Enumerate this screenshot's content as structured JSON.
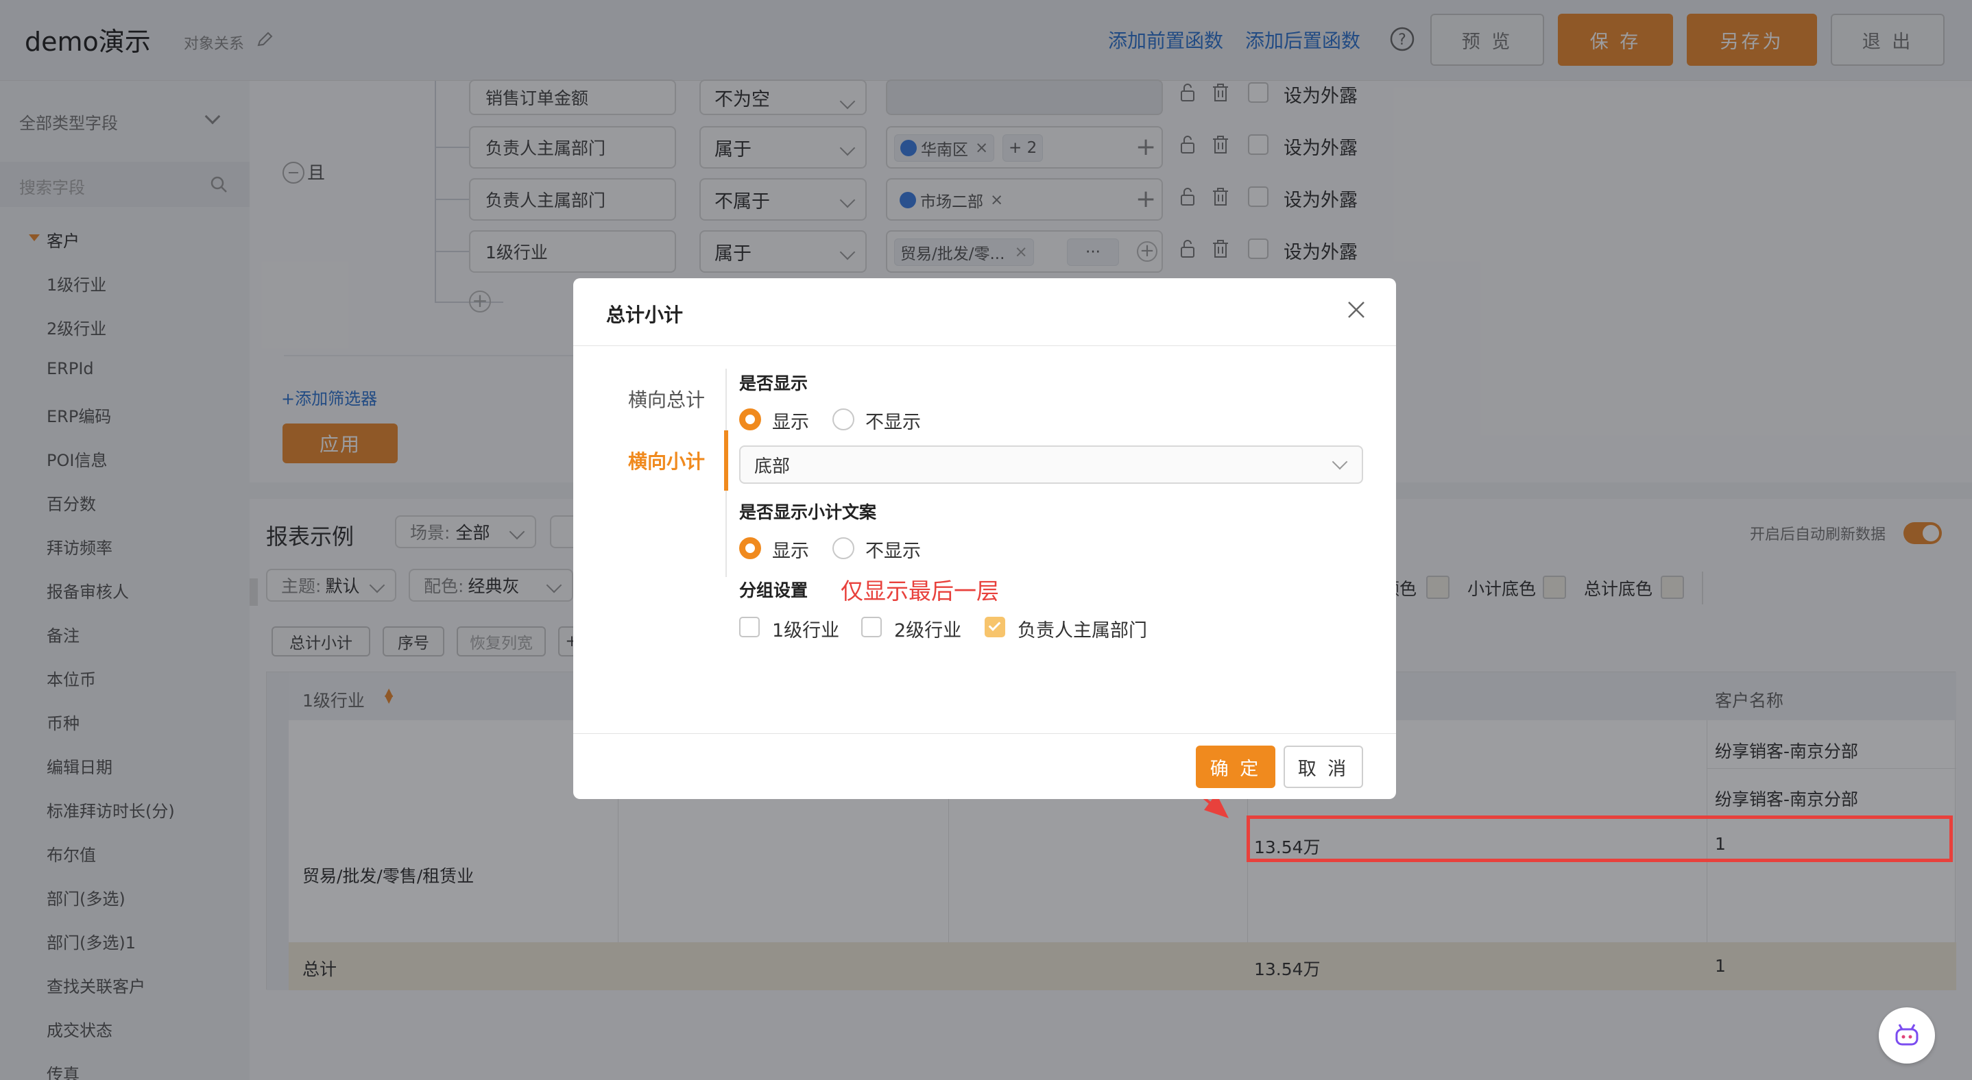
{
  "header": {
    "app_title": "demo演示",
    "object_relation": "对象关系",
    "add_pre_function": "添加前置函数",
    "add_post_function": "添加后置函数",
    "preview": "预 览",
    "save": "保 存",
    "save_as": "另存为",
    "exit": "退 出"
  },
  "sidebar": {
    "field_type": "全部类型字段",
    "search_placeholder": "搜索字段",
    "group": "客户",
    "items": [
      "1级行业",
      "2级行业",
      "ERPId",
      "ERP编码",
      "POI信息",
      "百分数",
      "拜访频率",
      "报备审核人",
      "备注",
      "本位币",
      "币种",
      "编辑日期",
      "标准拜访时长(分)",
      "布尔值",
      "部门(多选)",
      "部门(多选)1",
      "查找关联客户",
      "成交状态",
      "传真"
    ]
  },
  "filters": {
    "logic_label": "且",
    "rows": [
      {
        "field": "销售订单金额",
        "operator": "不为空",
        "values": [],
        "expose": "设为外露"
      },
      {
        "field": "负责人主属部门",
        "operator": "属于",
        "values": [
          "华南区"
        ],
        "extra_count": "+ 2",
        "expose": "设为外露"
      },
      {
        "field": "负责人主属部门",
        "operator": "不属于",
        "values": [
          "市场二部"
        ],
        "expose": "设为外露"
      },
      {
        "field": "1级行业",
        "operator": "属于",
        "values": [
          "贸易/批发/零..."
        ],
        "more": "···",
        "expose": "设为外露"
      }
    ],
    "add_filter": "+添加筛选器",
    "apply": "应用"
  },
  "report": {
    "title": "报表示例",
    "scene_label": "场景:",
    "scene_value": "全部",
    "theme_label": "主题:",
    "theme_value": "默认",
    "color_label": "配色:",
    "color_value": "经典灰",
    "auto_refresh": "开启后自动刷新数据",
    "bg_color_partial": "颜色",
    "subtotal_bg": "小计底色",
    "total_bg": "总计底色",
    "toolbar_buttons": [
      "总计小计",
      "序号",
      "恢复列宽"
    ],
    "columns": [
      "1级行业",
      "客户名称"
    ],
    "group_value": "贸易/批发/零售/租赁业",
    "rows": [
      {
        "customer": "纷享销客-南京分部"
      },
      {
        "customer": "纷享销客-南京分部"
      }
    ],
    "subtotal": {
      "amount": "13.54万",
      "count": "1"
    },
    "total": {
      "label": "总计",
      "amount": "13.54万",
      "count": "1"
    }
  },
  "modal": {
    "title": "总计小计",
    "tabs": [
      "横向总计",
      "横向小计"
    ],
    "active_tab": 1,
    "show_label": "是否显示",
    "show_options": [
      "显示",
      "不显示"
    ],
    "position_value": "底部",
    "show_text_label": "是否显示小计文案",
    "text_options": [
      "显示",
      "不显示"
    ],
    "group_label": "分组设置",
    "annotation": "仅显示最后一层",
    "groups": [
      {
        "label": "1级行业",
        "checked": false
      },
      {
        "label": "2级行业",
        "checked": false
      },
      {
        "label": "负责人主属部门",
        "checked": true
      }
    ],
    "confirm": "确 定",
    "cancel": "取 消"
  },
  "colors": {
    "accent": "#f08a1e",
    "link": "#2e73ce",
    "annotation": "#e8413c"
  }
}
